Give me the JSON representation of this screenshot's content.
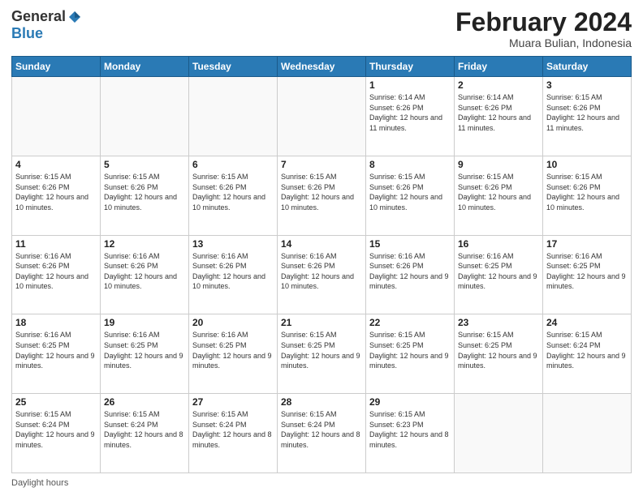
{
  "logo": {
    "general": "General",
    "blue": "Blue"
  },
  "header": {
    "month": "February 2024",
    "location": "Muara Bulian, Indonesia"
  },
  "days_of_week": [
    "Sunday",
    "Monday",
    "Tuesday",
    "Wednesday",
    "Thursday",
    "Friday",
    "Saturday"
  ],
  "weeks": [
    [
      {
        "day": "",
        "info": ""
      },
      {
        "day": "",
        "info": ""
      },
      {
        "day": "",
        "info": ""
      },
      {
        "day": "",
        "info": ""
      },
      {
        "day": "1",
        "info": "Sunrise: 6:14 AM\nSunset: 6:26 PM\nDaylight: 12 hours and 11 minutes."
      },
      {
        "day": "2",
        "info": "Sunrise: 6:14 AM\nSunset: 6:26 PM\nDaylight: 12 hours and 11 minutes."
      },
      {
        "day": "3",
        "info": "Sunrise: 6:15 AM\nSunset: 6:26 PM\nDaylight: 12 hours and 11 minutes."
      }
    ],
    [
      {
        "day": "4",
        "info": "Sunrise: 6:15 AM\nSunset: 6:26 PM\nDaylight: 12 hours and 10 minutes."
      },
      {
        "day": "5",
        "info": "Sunrise: 6:15 AM\nSunset: 6:26 PM\nDaylight: 12 hours and 10 minutes."
      },
      {
        "day": "6",
        "info": "Sunrise: 6:15 AM\nSunset: 6:26 PM\nDaylight: 12 hours and 10 minutes."
      },
      {
        "day": "7",
        "info": "Sunrise: 6:15 AM\nSunset: 6:26 PM\nDaylight: 12 hours and 10 minutes."
      },
      {
        "day": "8",
        "info": "Sunrise: 6:15 AM\nSunset: 6:26 PM\nDaylight: 12 hours and 10 minutes."
      },
      {
        "day": "9",
        "info": "Sunrise: 6:15 AM\nSunset: 6:26 PM\nDaylight: 12 hours and 10 minutes."
      },
      {
        "day": "10",
        "info": "Sunrise: 6:15 AM\nSunset: 6:26 PM\nDaylight: 12 hours and 10 minutes."
      }
    ],
    [
      {
        "day": "11",
        "info": "Sunrise: 6:16 AM\nSunset: 6:26 PM\nDaylight: 12 hours and 10 minutes."
      },
      {
        "day": "12",
        "info": "Sunrise: 6:16 AM\nSunset: 6:26 PM\nDaylight: 12 hours and 10 minutes."
      },
      {
        "day": "13",
        "info": "Sunrise: 6:16 AM\nSunset: 6:26 PM\nDaylight: 12 hours and 10 minutes."
      },
      {
        "day": "14",
        "info": "Sunrise: 6:16 AM\nSunset: 6:26 PM\nDaylight: 12 hours and 10 minutes."
      },
      {
        "day": "15",
        "info": "Sunrise: 6:16 AM\nSunset: 6:26 PM\nDaylight: 12 hours and 9 minutes."
      },
      {
        "day": "16",
        "info": "Sunrise: 6:16 AM\nSunset: 6:25 PM\nDaylight: 12 hours and 9 minutes."
      },
      {
        "day": "17",
        "info": "Sunrise: 6:16 AM\nSunset: 6:25 PM\nDaylight: 12 hours and 9 minutes."
      }
    ],
    [
      {
        "day": "18",
        "info": "Sunrise: 6:16 AM\nSunset: 6:25 PM\nDaylight: 12 hours and 9 minutes."
      },
      {
        "day": "19",
        "info": "Sunrise: 6:16 AM\nSunset: 6:25 PM\nDaylight: 12 hours and 9 minutes."
      },
      {
        "day": "20",
        "info": "Sunrise: 6:16 AM\nSunset: 6:25 PM\nDaylight: 12 hours and 9 minutes."
      },
      {
        "day": "21",
        "info": "Sunrise: 6:15 AM\nSunset: 6:25 PM\nDaylight: 12 hours and 9 minutes."
      },
      {
        "day": "22",
        "info": "Sunrise: 6:15 AM\nSunset: 6:25 PM\nDaylight: 12 hours and 9 minutes."
      },
      {
        "day": "23",
        "info": "Sunrise: 6:15 AM\nSunset: 6:25 PM\nDaylight: 12 hours and 9 minutes."
      },
      {
        "day": "24",
        "info": "Sunrise: 6:15 AM\nSunset: 6:24 PM\nDaylight: 12 hours and 9 minutes."
      }
    ],
    [
      {
        "day": "25",
        "info": "Sunrise: 6:15 AM\nSunset: 6:24 PM\nDaylight: 12 hours and 9 minutes."
      },
      {
        "day": "26",
        "info": "Sunrise: 6:15 AM\nSunset: 6:24 PM\nDaylight: 12 hours and 8 minutes."
      },
      {
        "day": "27",
        "info": "Sunrise: 6:15 AM\nSunset: 6:24 PM\nDaylight: 12 hours and 8 minutes."
      },
      {
        "day": "28",
        "info": "Sunrise: 6:15 AM\nSunset: 6:24 PM\nDaylight: 12 hours and 8 minutes."
      },
      {
        "day": "29",
        "info": "Sunrise: 6:15 AM\nSunset: 6:23 PM\nDaylight: 12 hours and 8 minutes."
      },
      {
        "day": "",
        "info": ""
      },
      {
        "day": "",
        "info": ""
      }
    ]
  ],
  "footer": {
    "text": "Daylight hours",
    "url": "https://www.generalblue.com"
  }
}
